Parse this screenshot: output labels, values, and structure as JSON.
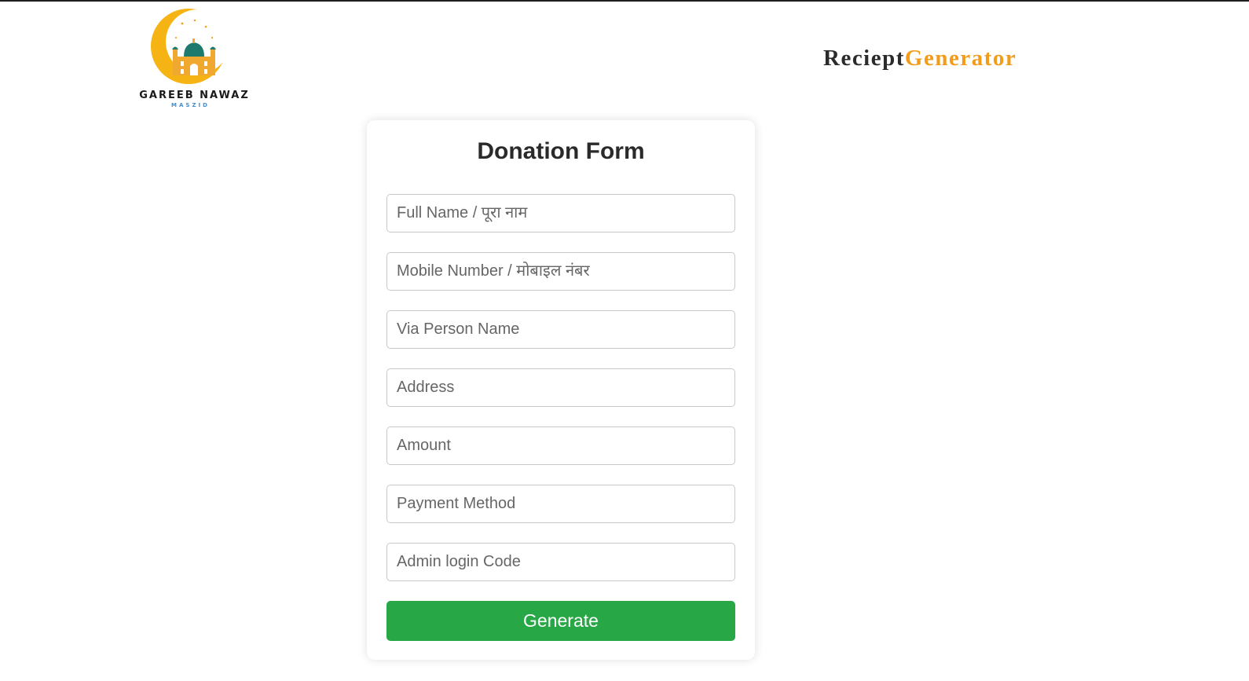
{
  "header": {
    "logo": {
      "name": "GAREEB NAWAZ",
      "sub": "MASZID"
    },
    "brand": {
      "part1": "Reciept",
      "part2": "Generator"
    }
  },
  "form": {
    "title": "Donation Form",
    "fields": [
      {
        "placeholder": "Full Name / पूरा नाम",
        "value": ""
      },
      {
        "placeholder": "Mobile Number / मोबाइल नंबर",
        "value": ""
      },
      {
        "placeholder": "Via Person Name",
        "value": ""
      },
      {
        "placeholder": "Address",
        "value": ""
      },
      {
        "placeholder": "Amount",
        "value": ""
      },
      {
        "placeholder": "Payment Method",
        "value": ""
      },
      {
        "placeholder": "Admin login Code",
        "value": ""
      }
    ],
    "submit_label": "Generate"
  },
  "colors": {
    "accent": "#f39c1a",
    "button": "#27a745",
    "logo_sub": "#3d8fd6",
    "dome": "#1f7a6e"
  },
  "icons": {
    "logo": "mosque-crescent-logo"
  }
}
